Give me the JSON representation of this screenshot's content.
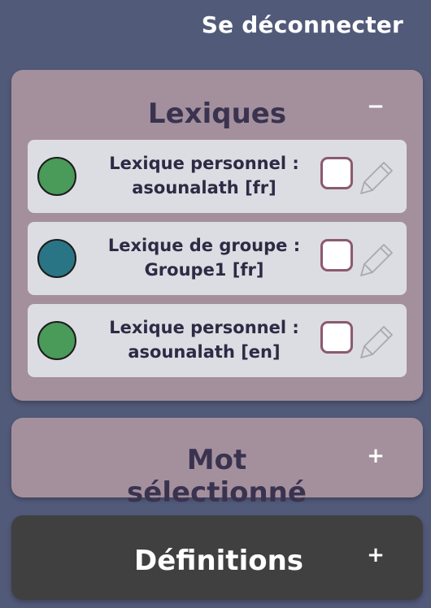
{
  "header": {
    "logout_label": "Se déconnecter"
  },
  "lexiques": {
    "title": "Lexiques",
    "toggle": "−",
    "items": [
      {
        "line1": "Lexique personnel :",
        "line2": "asounalath [fr]",
        "color": "#4a9a5a",
        "checked": false
      },
      {
        "line1": "Lexique de groupe :",
        "line2": "Groupe1 [fr]",
        "color": "#2a7585",
        "checked": false
      },
      {
        "line1": "Lexique personnel :",
        "line2": "asounalath [en]",
        "color": "#4a9a5a",
        "checked": false
      }
    ]
  },
  "mot_selectionne": {
    "title": "Mot sélectionné",
    "toggle": "+"
  },
  "definitions": {
    "title": "Définitions",
    "toggle": "+"
  },
  "icons": {
    "edit": "pencil-icon"
  }
}
